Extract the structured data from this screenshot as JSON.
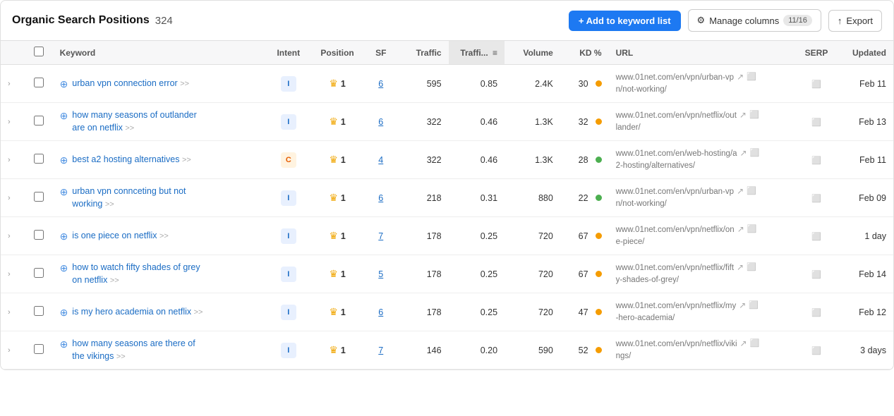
{
  "header": {
    "title": "Organic Search Positions",
    "count": "324",
    "add_btn": "+ Add to keyword list",
    "manage_btn": "Manage columns",
    "manage_badge": "11/16",
    "export_btn": "Export"
  },
  "columns": [
    {
      "key": "keyword",
      "label": "Keyword"
    },
    {
      "key": "intent",
      "label": "Intent"
    },
    {
      "key": "position",
      "label": "Position"
    },
    {
      "key": "sf",
      "label": "SF"
    },
    {
      "key": "traffic",
      "label": "Traffic"
    },
    {
      "key": "traffic_pct",
      "label": "Traffi...",
      "sorted": true
    },
    {
      "key": "volume",
      "label": "Volume"
    },
    {
      "key": "kd",
      "label": "KD %"
    },
    {
      "key": "url",
      "label": "URL"
    },
    {
      "key": "serp",
      "label": "SERP"
    },
    {
      "key": "updated",
      "label": "Updated"
    }
  ],
  "rows": [
    {
      "keyword": "urban vpn connection error",
      "intent": "I",
      "intent_type": "i",
      "position": "1",
      "sf": "6",
      "traffic": "595",
      "traffic_pct": "0.85",
      "volume": "2.4K",
      "kd": "30",
      "kd_dot": "orange",
      "url": "www.01net.com/en/vpn/urban-vp\nn/not-working/",
      "updated": "Feb 11"
    },
    {
      "keyword": "how many seasons of outlander\nare on netflix",
      "intent": "I",
      "intent_type": "i",
      "position": "1",
      "sf": "6",
      "traffic": "322",
      "traffic_pct": "0.46",
      "volume": "1.3K",
      "kd": "32",
      "kd_dot": "orange",
      "url": "www.01net.com/en/vpn/netflix/out\nlander/",
      "updated": "Feb 13"
    },
    {
      "keyword": "best a2 hosting alternatives",
      "intent": "C",
      "intent_type": "c",
      "position": "1",
      "sf": "4",
      "traffic": "322",
      "traffic_pct": "0.46",
      "volume": "1.3K",
      "kd": "28",
      "kd_dot": "green",
      "url": "www.01net.com/en/web-hosting/a\n2-hosting/alternatives/",
      "updated": "Feb 11"
    },
    {
      "keyword": "urban vpn connceting but not\nworking",
      "intent": "I",
      "intent_type": "i",
      "position": "1",
      "sf": "6",
      "traffic": "218",
      "traffic_pct": "0.31",
      "volume": "880",
      "kd": "22",
      "kd_dot": "green",
      "url": "www.01net.com/en/vpn/urban-vp\nn/not-working/",
      "updated": "Feb 09"
    },
    {
      "keyword": "is one piece on netflix",
      "intent": "I",
      "intent_type": "i",
      "position": "1",
      "sf": "7",
      "traffic": "178",
      "traffic_pct": "0.25",
      "volume": "720",
      "kd": "67",
      "kd_dot": "orange",
      "url": "www.01net.com/en/vpn/netflix/on\ne-piece/",
      "updated": "1 day"
    },
    {
      "keyword": "how to watch fifty shades of grey\non netflix",
      "intent": "I",
      "intent_type": "i",
      "position": "1",
      "sf": "5",
      "traffic": "178",
      "traffic_pct": "0.25",
      "volume": "720",
      "kd": "67",
      "kd_dot": "orange",
      "url": "www.01net.com/en/vpn/netflix/fift\ny-shades-of-grey/",
      "updated": "Feb 14"
    },
    {
      "keyword": "is my hero academia on netflix",
      "intent": "I",
      "intent_type": "i",
      "position": "1",
      "sf": "6",
      "traffic": "178",
      "traffic_pct": "0.25",
      "volume": "720",
      "kd": "47",
      "kd_dot": "orange",
      "url": "www.01net.com/en/vpn/netflix/my\n-hero-academia/",
      "updated": "Feb 12"
    },
    {
      "keyword": "how many seasons are there of\nthe vikings",
      "intent": "I",
      "intent_type": "i",
      "position": "1",
      "sf": "7",
      "traffic": "146",
      "traffic_pct": "0.20",
      "volume": "590",
      "kd": "52",
      "kd_dot": "orange",
      "url": "www.01net.com/en/vpn/netflix/viki\nngs/",
      "updated": "3 days"
    }
  ]
}
